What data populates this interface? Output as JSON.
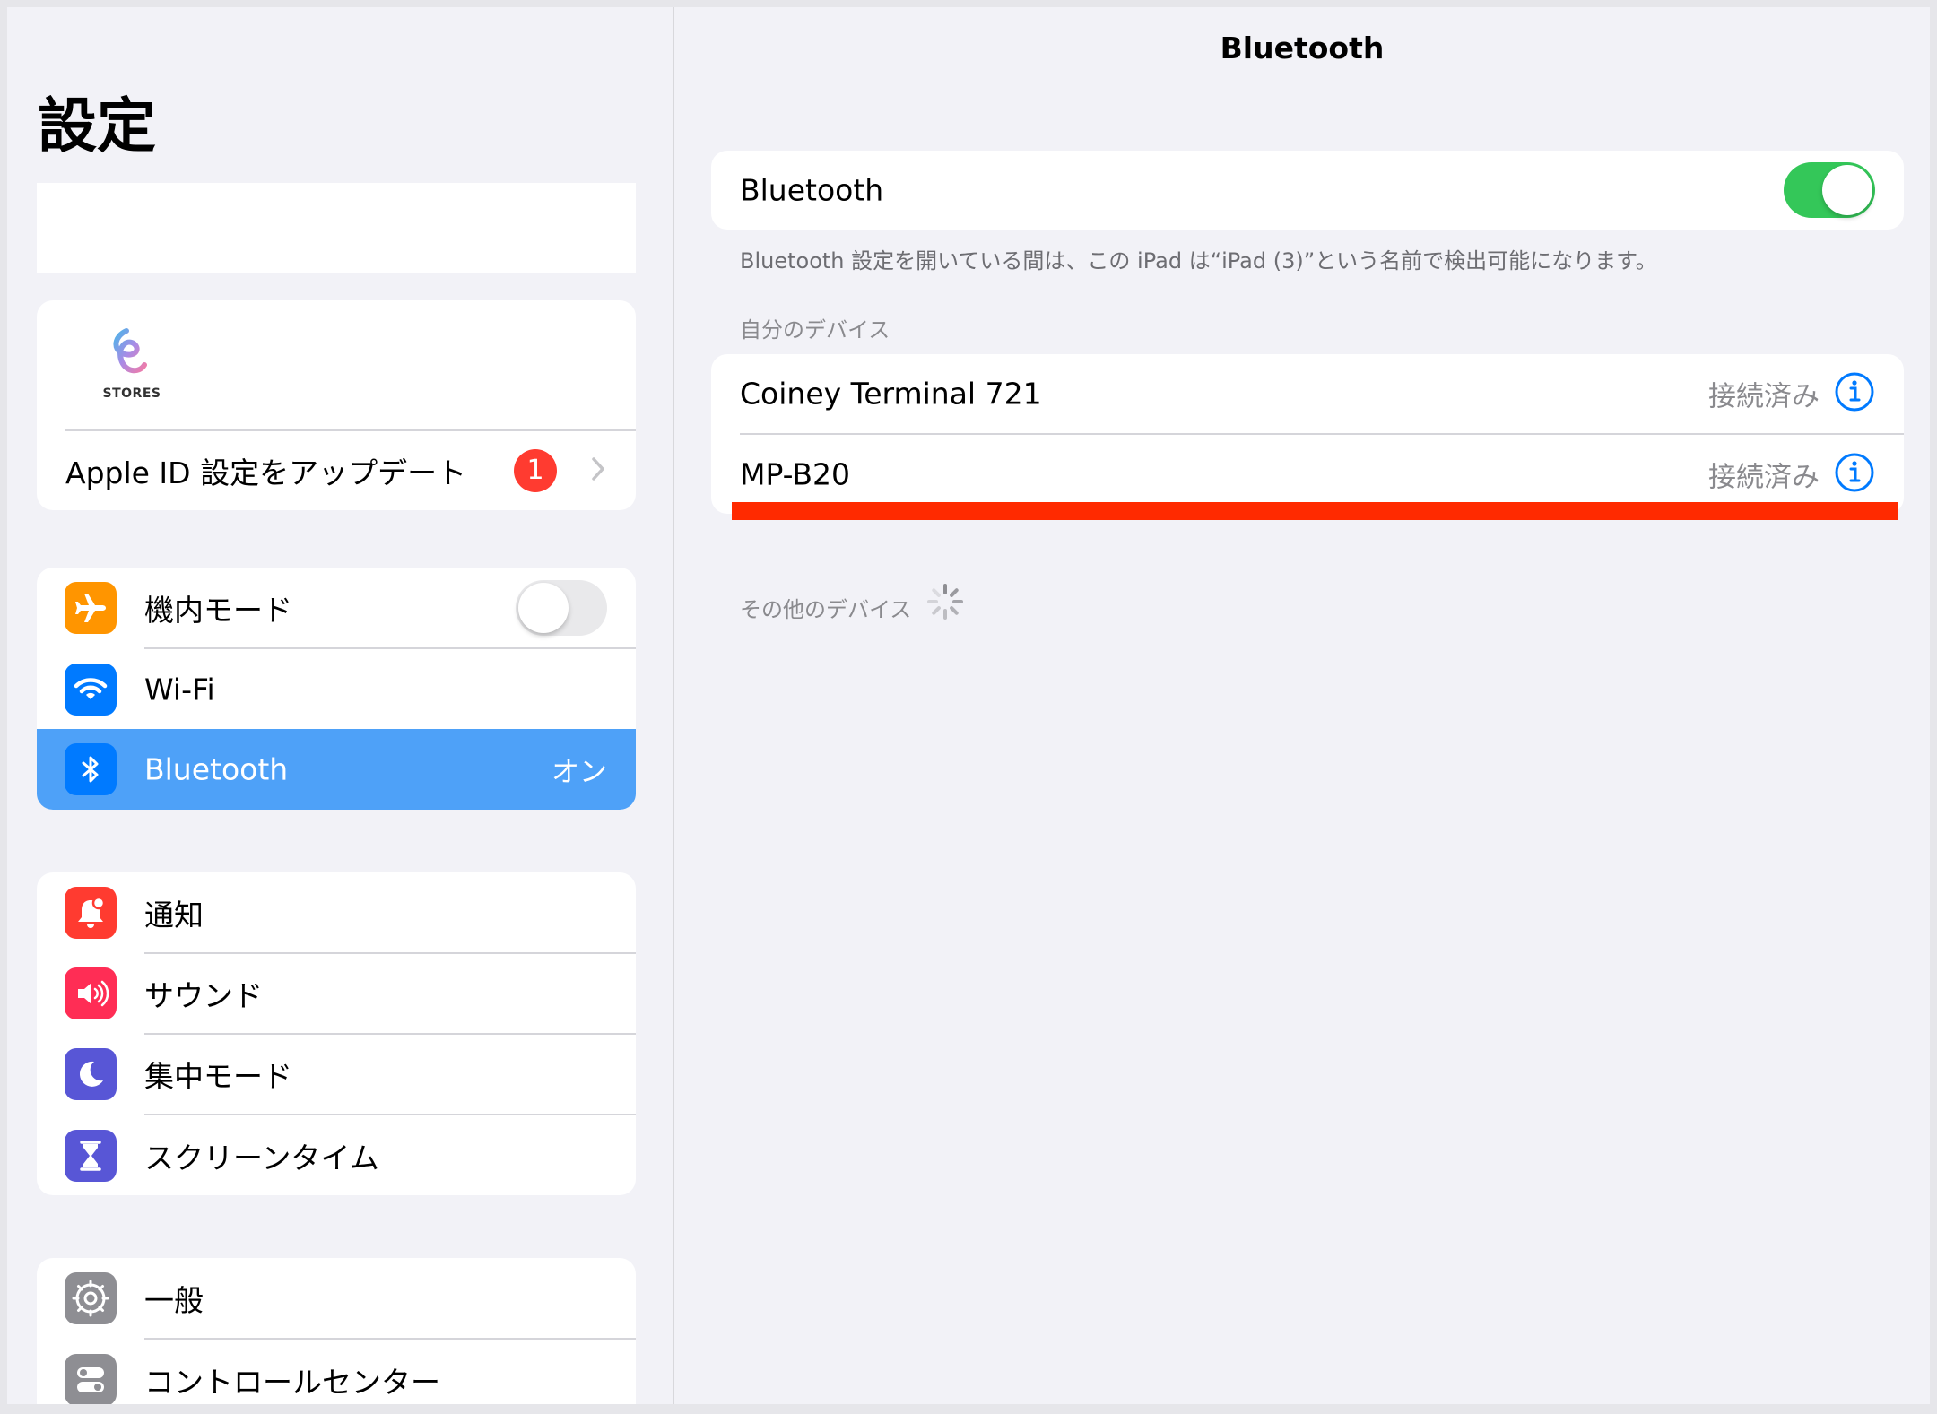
{
  "sidebar": {
    "title": "設定",
    "account": {
      "logo_icon": "stores-logo-icon",
      "logo_text": "STORES",
      "update_label": "Apple ID 設定をアップデート",
      "badge_count": "1"
    },
    "connectivity": [
      {
        "label": "機内モード",
        "icon": "airplane-icon",
        "color": "#ff9500"
      },
      {
        "label": "Wi-Fi",
        "icon": "wifi-icon",
        "color": "#007aff"
      },
      {
        "label": "Bluetooth",
        "value": "オン",
        "icon": "bluetooth-icon",
        "color": "#007aff",
        "selected": true
      }
    ],
    "notifications": [
      {
        "label": "通知",
        "icon": "bell-icon",
        "color": "#ff3b30"
      },
      {
        "label": "サウンド",
        "icon": "speaker-icon",
        "color": "#ff2d55"
      },
      {
        "label": "集中モード",
        "icon": "moon-icon",
        "color": "#5856d6"
      },
      {
        "label": "スクリーンタイム",
        "icon": "hourglass-icon",
        "color": "#5856d6"
      }
    ],
    "general": [
      {
        "label": "一般",
        "icon": "gear-icon",
        "color": "#8e8e93"
      },
      {
        "label": "コントロールセンター",
        "icon": "switches-icon",
        "color": "#8e8e93"
      }
    ]
  },
  "detail": {
    "title": "Bluetooth",
    "bluetooth_toggle": {
      "label": "Bluetooth",
      "on": true
    },
    "footnote": "Bluetooth 設定を開いている間は、この iPad は“iPad (3)”という名前で検出可能になります。",
    "my_devices_header": "自分のデバイス",
    "my_devices": [
      {
        "name": "Coiney Terminal 721",
        "status": "接続済み"
      },
      {
        "name": "MP-B20",
        "status": "接続済み"
      }
    ],
    "other_devices_header": "その他のデバイス"
  },
  "colors": {
    "accent": "#007aff",
    "toggle_on": "#34c759",
    "selected_row": "#4ea1f8",
    "badge": "#ff3b30",
    "highlight": "#ff2a00"
  }
}
